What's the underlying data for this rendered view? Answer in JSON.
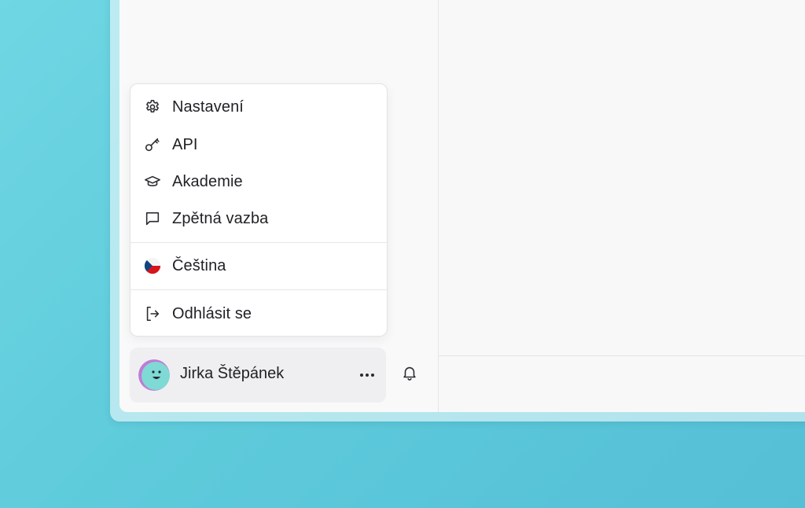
{
  "menu": {
    "items": [
      {
        "label": "Nastavení",
        "icon": "gear-icon"
      },
      {
        "label": "API",
        "icon": "key-icon"
      },
      {
        "label": "Akademie",
        "icon": "graduation-cap-icon"
      },
      {
        "label": "Zpětná vazba",
        "icon": "message-square-icon"
      }
    ],
    "language": {
      "label": "Čeština",
      "icon": "czech-flag-icon"
    },
    "logout": {
      "label": "Odhlásit se",
      "icon": "logout-icon"
    }
  },
  "user": {
    "name": "Jirka Štěpánek",
    "more_icon": "more-horizontal-icon"
  },
  "notifications": {
    "icon": "bell-icon"
  },
  "colors": {
    "background": "#5ecbdb",
    "menu_bg": "#ffffff",
    "user_bar_bg": "#efeff1",
    "text": "#222226",
    "avatar_bg": "#7fd9d4",
    "avatar_ring": "#c07ad6"
  }
}
